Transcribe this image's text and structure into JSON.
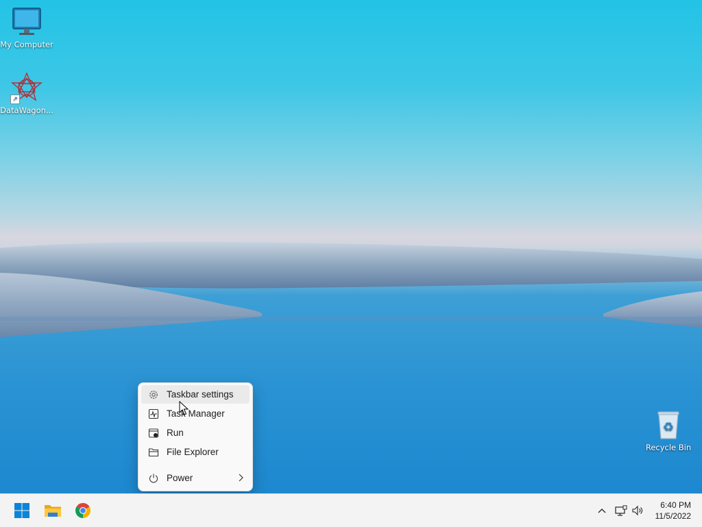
{
  "desktop": {
    "icons": [
      {
        "label": "My Computer",
        "icon": "monitor-icon"
      },
      {
        "label": "DataWagon...",
        "icon": "datawagon-icon"
      },
      {
        "label": "Recycle Bin",
        "icon": "recycle-bin-icon"
      }
    ]
  },
  "context_menu": {
    "items": [
      {
        "label": "Taskbar settings",
        "icon": "gear-icon"
      },
      {
        "label": "Task Manager",
        "icon": "task-manager-icon"
      },
      {
        "label": "Run",
        "icon": "run-icon"
      },
      {
        "label": "File Explorer",
        "icon": "folder-icon"
      },
      {
        "label": "Power",
        "icon": "power-icon",
        "submenu": true
      }
    ]
  },
  "taskbar": {
    "pinned": [
      {
        "name": "Start",
        "icon": "windows-logo-icon"
      },
      {
        "name": "File Explorer",
        "icon": "folder-icon"
      },
      {
        "name": "Google Chrome",
        "icon": "chrome-icon"
      }
    ],
    "tray": {
      "icons": [
        "chevron-up-icon",
        "network-icon",
        "volume-icon"
      ],
      "time": "6:40 PM",
      "date": "11/5/2022"
    }
  },
  "colors": {
    "accent": "#0078d4",
    "taskbar_bg": "#f3f3f3",
    "menu_bg": "#f9f9f9"
  }
}
